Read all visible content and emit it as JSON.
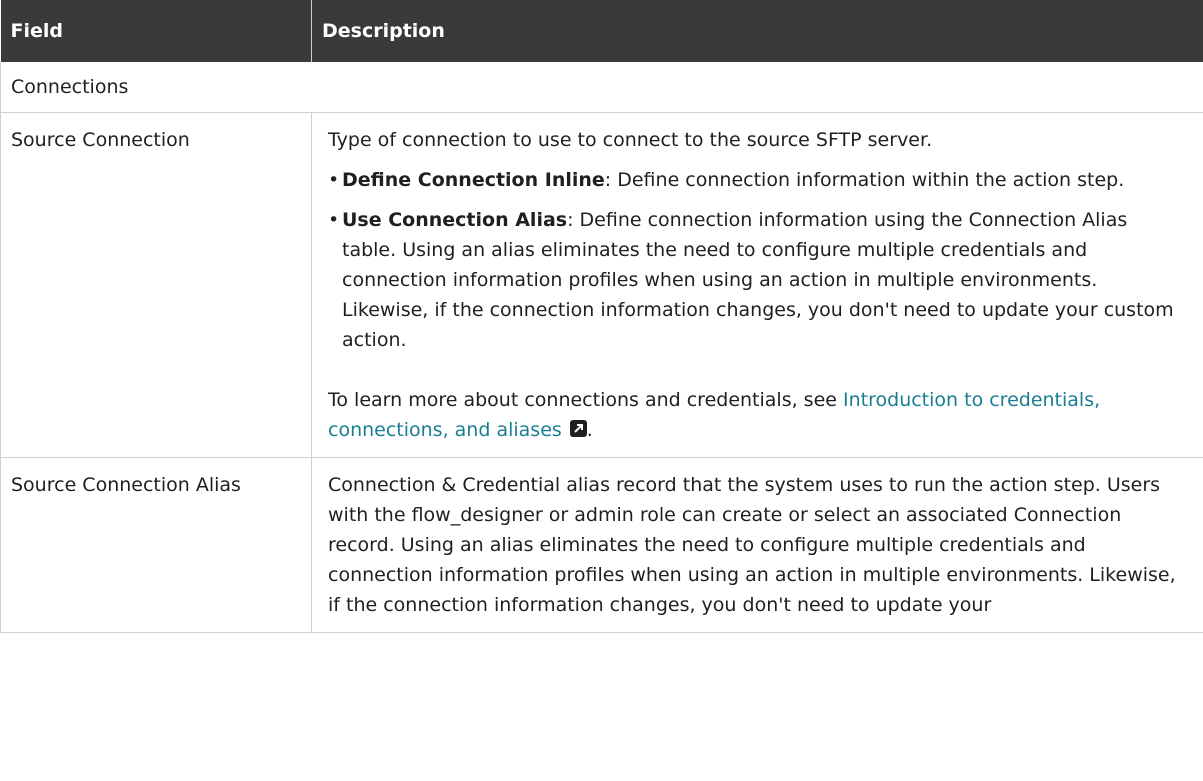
{
  "header": {
    "field": "Field",
    "description": "Description"
  },
  "section": {
    "title": "Connections"
  },
  "rows": [
    {
      "field": "Source Connection",
      "intro": "Type of connection to use to connect to the source SFTP server.",
      "bullets": [
        {
          "term": "Define Connection Inline",
          "text": ": Define connection information within the action step."
        },
        {
          "term": "Use Connection Alias",
          "text": ": Define connection information using the Connection Alias table. Using an alias eliminates the need to configure multiple credentials and connection information profiles when using an action in multiple environments. Likewise, if the connection information changes, you don't need to update your custom action."
        }
      ],
      "learn_prefix": "To learn more about connections and credentials, see ",
      "learn_link": "Introduction to credentials, connections, and aliases",
      "learn_suffix": "."
    },
    {
      "field": "Source Connection Alias",
      "description": "Connection & Credential alias record that the system uses to run the action step. Users with the flow_designer or admin role can create or select an associated Connection record. Using an alias eliminates the need to configure multiple credentials and connection information profiles when using an action in multiple environments. Likewise, if the connection information changes, you don't need to update your"
    }
  ],
  "icons": {
    "external_link": "external-link-icon"
  },
  "colors": {
    "header_bg": "#3a3a3a",
    "link": "#1a7e93"
  }
}
